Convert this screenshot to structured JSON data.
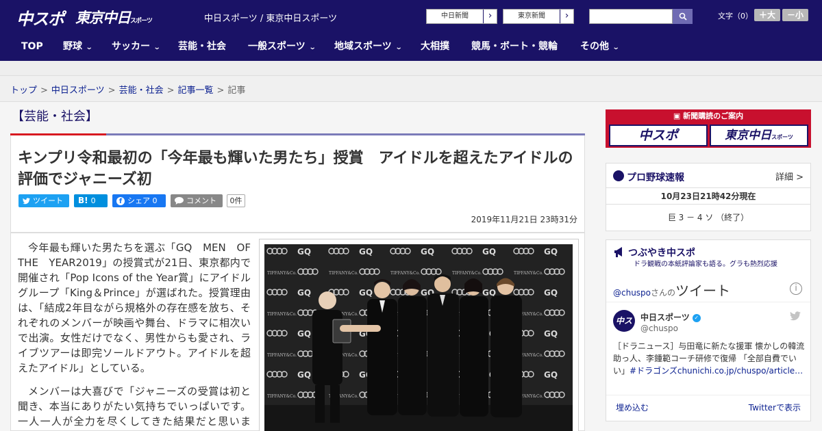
{
  "header": {
    "logo_chuspo": "中スポ",
    "logo_tokyo": "東京中日",
    "logo_tokyo_small": "スポーツ",
    "site_links": "中日スポーツ / 東京中日スポーツ",
    "paper_links": [
      {
        "label": "中日新聞",
        "arrow": "›"
      },
      {
        "label": "東京新聞",
        "arrow": "›"
      }
    ],
    "search_placeholder": "",
    "font_size_label": "文字（0）",
    "font_increase": "＋大",
    "font_decrease": "－小",
    "brand_color": "#1a1266"
  },
  "nav": {
    "items": [
      {
        "label": "TOP",
        "has_menu": false
      },
      {
        "label": "野球",
        "has_menu": true
      },
      {
        "label": "サッカー",
        "has_menu": true
      },
      {
        "label": "芸能・社会",
        "has_menu": false
      },
      {
        "label": "一般スポーツ",
        "has_menu": true
      },
      {
        "label": "地域スポーツ",
        "has_menu": true
      },
      {
        "label": "大相撲",
        "has_menu": false
      },
      {
        "label": "競馬・ボート・競輪",
        "has_menu": false
      },
      {
        "label": "その他",
        "has_menu": true
      }
    ],
    "chevron": "⌄"
  },
  "breadcrumb": {
    "items": [
      "トップ",
      "中日スポーツ",
      "芸能・社会",
      "記事一覧"
    ],
    "current": "記事",
    "separator": ">"
  },
  "article": {
    "category": "【芸能・社会】",
    "headline": "キンプリ令和最初の「今年最も輝いた男たち」授賞　アイドルを超えたアイドルの評価でジャニーズ初",
    "share": {
      "tweet": "ツイート",
      "hatena_count": "0",
      "facebook": "シェア 0",
      "comment": "コメント",
      "comment_count": "0件"
    },
    "date": "2019年11月21日 23時31分",
    "paragraphs": [
      "今年最も輝いた男たちを選ぶ「GQ　MEN　OF　THE　YEAR2019」の授賞式が21日、東京都内で開催され「Pop Icons of the Year賞」にアイドルグループ「King＆Prince」が選ばれた。授賞理由は、「結成2年目ながら規格外の存在感を放ち、それぞれのメンバーが映画や舞台、ドラマに相次いで出演。女性だけでなく、男性からも愛され、ライブツアーは即完ソールドアウト。アイドルを超えたアイドル」としている。",
      "メンバーは大喜びで「ジャニーズの受賞は初と聞き、本当にありがたい気持ちでいっぱいです。一人一人が全力を尽くしてきた結果だと思います。"
    ],
    "photo_backdrop": [
      "GQ",
      "TIFFANY & Co."
    ]
  },
  "sidebar": {
    "promo_title": "新聞購読のご案内",
    "promo_chuspo": "中スポ",
    "promo_tokyo": "東京中日",
    "promo_tokyo_small": "スポーツ",
    "baseball": {
      "title": "プロ野球速報",
      "detail": "詳細 >",
      "time": "10月23日21時42分現在",
      "score": "巨 3 － 4 ソ （終了）"
    },
    "tsubuyaki": {
      "title": "つぶやき中スポ",
      "subtitle": "ドラ観戦の本紙評論家も語る。グラも熱烈応援",
      "handle_link": "@chuspo",
      "handle_suffix": "さんの",
      "tweets_label": "ツイート",
      "account_name": "中日スポーツ",
      "account_handle": "@chuspo",
      "avatar_text": "中スポ",
      "tweet_text": "［ドラニュース］与田竜に新たな援軍 懐かしの韓流助っ人、李鍾範コーチ研修で復帰 「全部自費でい",
      "tweet_text2": "い」",
      "tweet_tag": "#ドラゴンズ",
      "tweet_link": "chunichi.co.jp/chuspo/article…",
      "embed": "埋め込む",
      "view_on_twitter": "Twitterで表示"
    }
  }
}
